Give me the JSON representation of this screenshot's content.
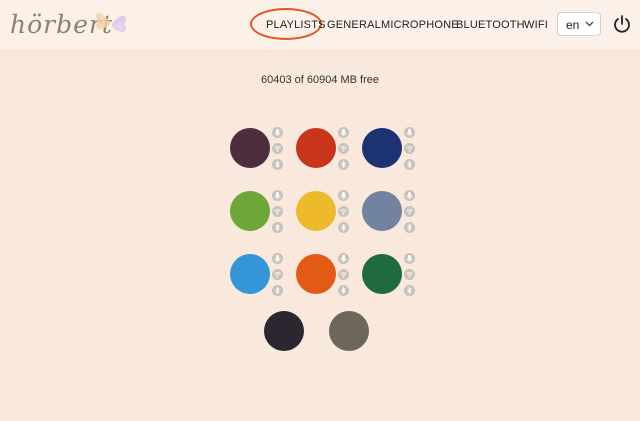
{
  "header": {
    "logo_text": "hörbert",
    "nav": [
      "PLAYLISTS",
      "GENERAL",
      "MICROPHONE",
      "BLUETOOTH",
      "WIFI"
    ],
    "language": "en"
  },
  "storage_text": "60403 of 60904 MB free",
  "playlists": [
    {
      "color": "#4e2d3f",
      "icons": [
        "microphone-icon",
        "wifi-icon",
        "bluetooth-icon"
      ]
    },
    {
      "color": "#c9341c",
      "icons": [
        "microphone-icon",
        "wifi-icon",
        "bluetooth-icon"
      ]
    },
    {
      "color": "#1c3272",
      "icons": [
        "microphone-icon",
        "wifi-icon",
        "bluetooth-icon"
      ]
    },
    {
      "color": "#6fa63a",
      "icons": [
        "microphone-icon",
        "wifi-icon",
        "bluetooth-icon"
      ]
    },
    {
      "color": "#ecba2a",
      "icons": [
        "microphone-icon",
        "wifi-icon",
        "bluetooth-icon"
      ]
    },
    {
      "color": "#71839f",
      "icons": [
        "microphone-icon",
        "wifi-icon",
        "bluetooth-icon"
      ]
    },
    {
      "color": "#3496d8",
      "icons": [
        "microphone-icon",
        "wifi-icon",
        "bluetooth-icon"
      ]
    },
    {
      "color": "#e25a14",
      "icons": [
        "microphone-icon",
        "wifi-icon",
        "bluetooth-icon"
      ]
    },
    {
      "color": "#1f6b3e",
      "icons": [
        "microphone-icon",
        "wifi-icon",
        "bluetooth-icon"
      ]
    },
    {
      "color": "#2c2630",
      "icons": []
    },
    {
      "color": "#6c665b",
      "icons": []
    }
  ],
  "colors": {
    "background": "#f8e9dc",
    "header": "#fbf1e8",
    "highlight": "#e2542c",
    "icon_badge": "#c8c2bd"
  }
}
